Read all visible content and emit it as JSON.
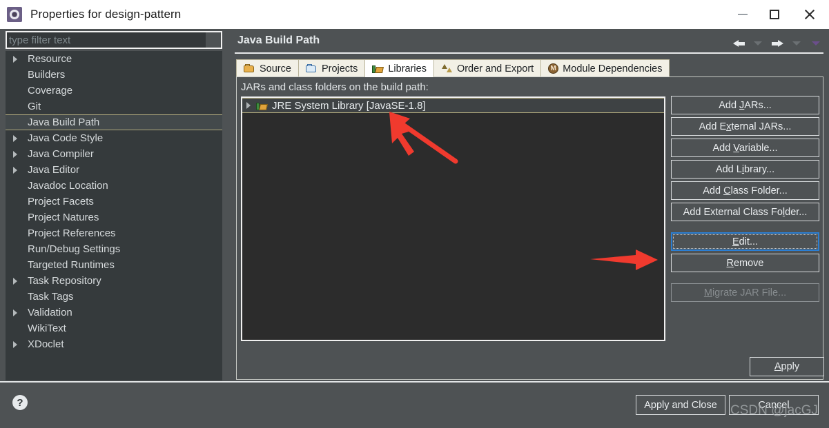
{
  "window": {
    "title": "Properties for design-pattern",
    "app_icon": "eclipse-properties-icon",
    "minimize_label": "Minimize",
    "maximize_label": "Maximize",
    "close_label": "Close"
  },
  "sidebar": {
    "filter": {
      "placeholder": "type filter text",
      "value": ""
    },
    "items": [
      {
        "label": "Resource",
        "expandable": true,
        "selected": false
      },
      {
        "label": "Builders",
        "expandable": false,
        "selected": false
      },
      {
        "label": "Coverage",
        "expandable": false,
        "selected": false
      },
      {
        "label": "Git",
        "expandable": false,
        "selected": false
      },
      {
        "label": "Java Build Path",
        "expandable": false,
        "selected": true
      },
      {
        "label": "Java Code Style",
        "expandable": true,
        "selected": false
      },
      {
        "label": "Java Compiler",
        "expandable": true,
        "selected": false
      },
      {
        "label": "Java Editor",
        "expandable": true,
        "selected": false
      },
      {
        "label": "Javadoc Location",
        "expandable": false,
        "selected": false
      },
      {
        "label": "Project Facets",
        "expandable": false,
        "selected": false
      },
      {
        "label": "Project Natures",
        "expandable": false,
        "selected": false
      },
      {
        "label": "Project References",
        "expandable": false,
        "selected": false
      },
      {
        "label": "Run/Debug Settings",
        "expandable": false,
        "selected": false
      },
      {
        "label": "Targeted Runtimes",
        "expandable": false,
        "selected": false
      },
      {
        "label": "Task Repository",
        "expandable": true,
        "selected": false
      },
      {
        "label": "Task Tags",
        "expandable": false,
        "selected": false
      },
      {
        "label": "Validation",
        "expandable": true,
        "selected": false
      },
      {
        "label": "WikiText",
        "expandable": false,
        "selected": false
      },
      {
        "label": "XDoclet",
        "expandable": true,
        "selected": false
      }
    ]
  },
  "page": {
    "title": "Java Build Path",
    "nav": {
      "back": "back-arrow",
      "back_menu": "back-dropdown",
      "forward": "forward-arrow",
      "forward_menu": "forward-dropdown",
      "view_menu": "view-menu"
    }
  },
  "tabs": [
    {
      "label": "Source",
      "icon": "package-icon",
      "active": false
    },
    {
      "label": "Projects",
      "icon": "open-folder-icon",
      "active": false
    },
    {
      "label": "Libraries",
      "icon": "books-icon",
      "active": true
    },
    {
      "label": "Order and Export",
      "icon": "order-arrows-icon",
      "active": false
    },
    {
      "label": "Module Dependencies",
      "icon": "module-icon",
      "active": false,
      "glyph": "M"
    }
  ],
  "libraries_tab": {
    "list_label": "JARs and class folders on the build path:",
    "entries": [
      {
        "label": "JRE System Library [JavaSE-1.8]",
        "icon": "library-icon",
        "expandable": true,
        "selected": true
      }
    ],
    "buttons": [
      {
        "label": "Add JARs...",
        "mnemonic_index": 4,
        "state": "normal"
      },
      {
        "label": "Add External JARs...",
        "mnemonic_index": 5,
        "state": "normal"
      },
      {
        "label": "Add Variable...",
        "mnemonic_index": 4,
        "state": "normal"
      },
      {
        "label": "Add Library...",
        "mnemonic_index": 5,
        "state": "normal"
      },
      {
        "label": "Add Class Folder...",
        "mnemonic_index": 4,
        "state": "normal"
      },
      {
        "label": "Add External Class Folder...",
        "mnemonic_index": 21,
        "state": "normal"
      },
      {
        "label": "Edit...",
        "mnemonic_index": 0,
        "state": "focused"
      },
      {
        "label": "Remove",
        "mnemonic_index": 0,
        "state": "normal"
      },
      {
        "label": "Migrate JAR File...",
        "mnemonic_index": 0,
        "state": "disabled"
      }
    ]
  },
  "footer": {
    "apply_label": "Apply",
    "apply_mnemonic_index": 0,
    "help_icon": "help-icon",
    "help_glyph": "?",
    "apply_and_close_label": "Apply and Close",
    "cancel_label": "Cancel",
    "watermark": "CSDN @jacGJ"
  },
  "annotations": [
    {
      "name": "arrow-to-jre-entry",
      "color": "#f03a2e",
      "direction": "up-left"
    },
    {
      "name": "arrow-to-edit-button",
      "color": "#f03a2e",
      "direction": "right"
    }
  ],
  "colors": {
    "dialog_bg": "#4e5254",
    "tree_bg": "#353a3c",
    "list_bg": "#2c2c2c",
    "titlebar_bg": "#ffffff",
    "selection_border": "#b2ab7e",
    "focus_blue": "#2b7fd4",
    "annotation_red": "#f03a2e"
  }
}
